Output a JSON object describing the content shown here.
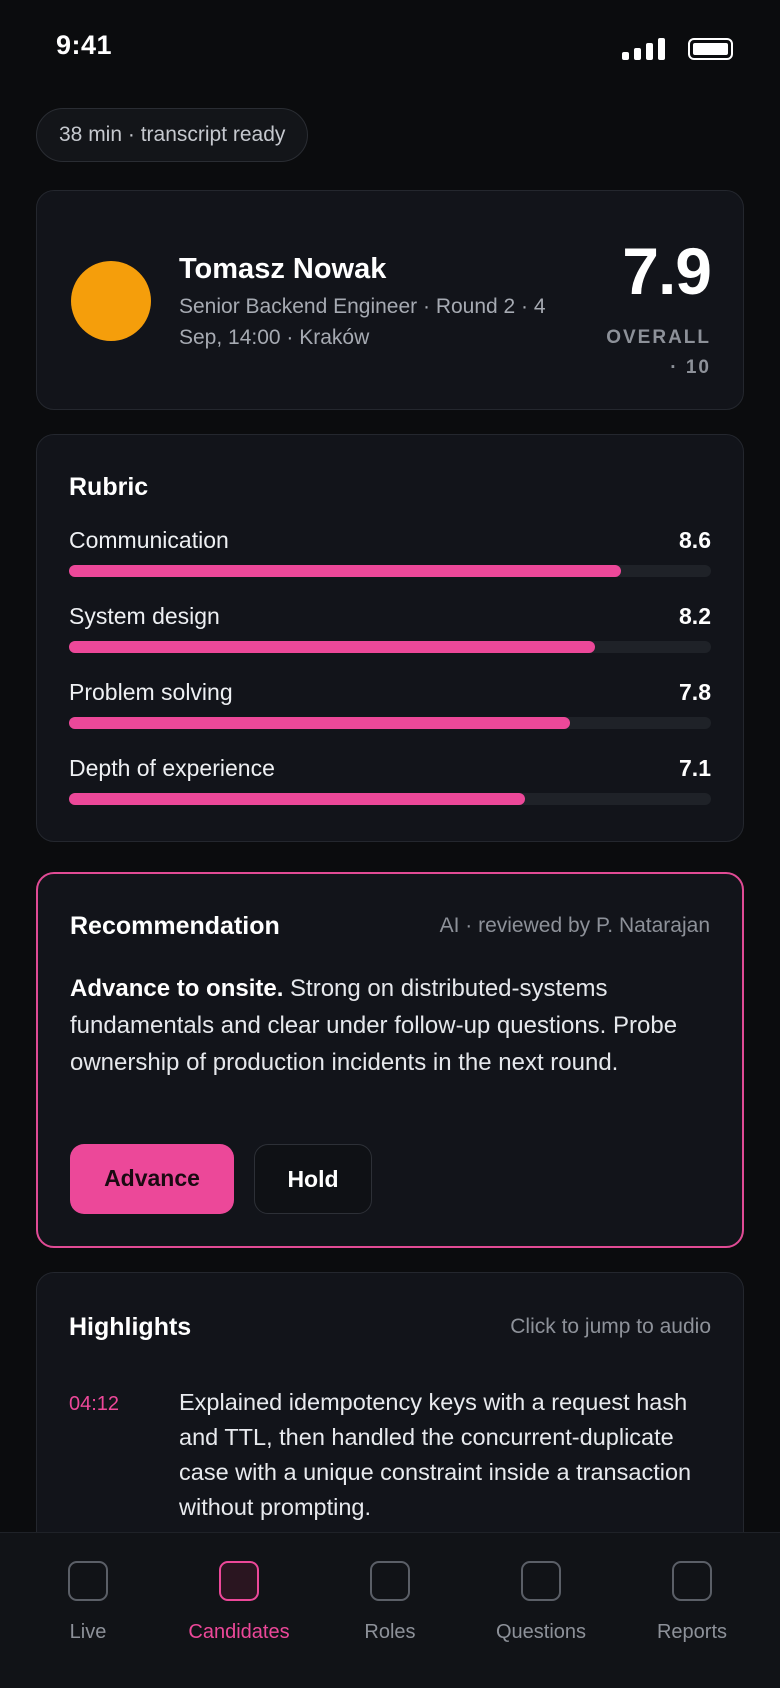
{
  "status_bar": {
    "time": "9:41"
  },
  "session": {
    "chip": "38 min · transcript ready"
  },
  "candidate": {
    "name": "Tomasz Nowak",
    "meta": "Senior Backend Engineer · Round 2 · 4 Sep, 14:00 · Kraków",
    "avatar_color": "#f59e0b",
    "overall_score": "7.9",
    "overall_label": "OVERALL · 10"
  },
  "rubric": {
    "title": "Rubric",
    "scale_max": 10,
    "items": [
      {
        "label": "Communication",
        "value": "8.6"
      },
      {
        "label": "System design",
        "value": "8.2"
      },
      {
        "label": "Problem solving",
        "value": "7.8"
      },
      {
        "label": "Depth of experience",
        "value": "7.1"
      }
    ]
  },
  "recommendation": {
    "title": "Recommendation",
    "reviewer": "AI · reviewed by P. Natarajan",
    "verdict": "Advance to onsite.",
    "body": " Strong on distributed-systems fundamentals and clear under follow-up questions. Probe ownership of production incidents in the next round.",
    "advance_label": "Advance",
    "hold_label": "Hold"
  },
  "highlights": {
    "title": "Highlights",
    "hint": "Click to jump to audio",
    "items": [
      {
        "time": "04:12",
        "text": "Explained idempotency keys with a request hash and TTL, then handled the concurrent-duplicate case with a unique constraint inside a transaction without prompting."
      }
    ]
  },
  "tabbar": {
    "active": "Candidates",
    "tabs": [
      {
        "label": "Live"
      },
      {
        "label": "Candidates"
      },
      {
        "label": "Roles"
      },
      {
        "label": "Questions"
      },
      {
        "label": "Reports"
      }
    ]
  },
  "colors": {
    "accent": "#ec4899",
    "background": "#0b0c0e",
    "card": "#12141a"
  }
}
